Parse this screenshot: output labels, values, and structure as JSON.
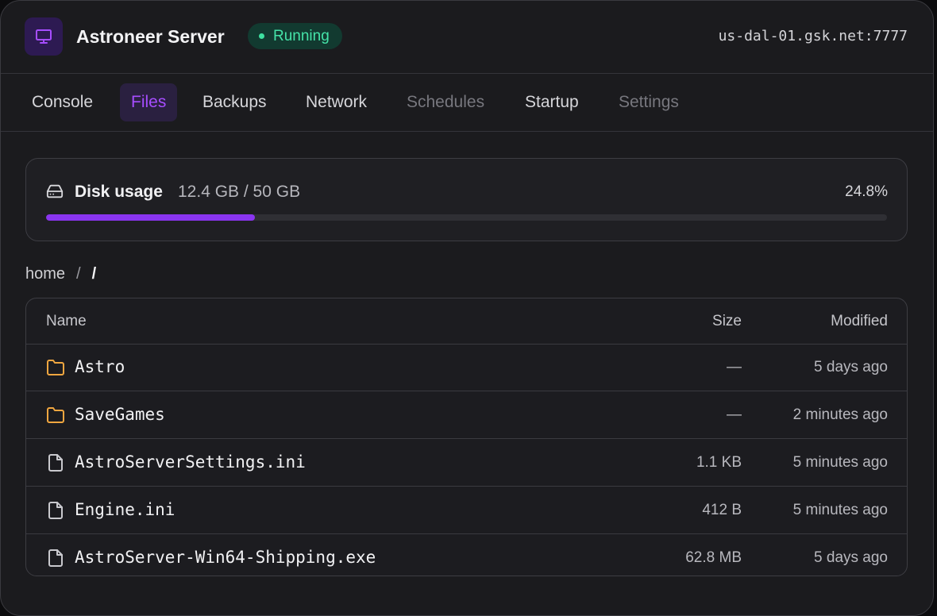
{
  "header": {
    "title": "Astroneer Server",
    "status": "Running",
    "address": "us-dal-01.gsk.net:7777",
    "icon": "monitor-icon"
  },
  "tabs": [
    {
      "label": "Console",
      "state": "normal"
    },
    {
      "label": "Files",
      "state": "active"
    },
    {
      "label": "Backups",
      "state": "normal"
    },
    {
      "label": "Network",
      "state": "normal"
    },
    {
      "label": "Schedules",
      "state": "disabled"
    },
    {
      "label": "Startup",
      "state": "normal"
    },
    {
      "label": "Settings",
      "state": "disabled"
    }
  ],
  "disk": {
    "label": "Disk usage",
    "used": "12.4 GB / 50 GB",
    "percent_label": "24.8%",
    "percent": 24.8,
    "icon": "hard-drive-icon"
  },
  "breadcrumb": {
    "root": "home",
    "separator": "/",
    "current": "/"
  },
  "table": {
    "columns": {
      "name": "Name",
      "size": "Size",
      "modified": "Modified"
    },
    "rows": [
      {
        "name": "Astro",
        "type": "folder",
        "size": "—",
        "modified": "5 days ago"
      },
      {
        "name": "SaveGames",
        "type": "folder",
        "size": "—",
        "modified": "2 minutes ago"
      },
      {
        "name": "AstroServerSettings.ini",
        "type": "file",
        "size": "1.1 KB",
        "modified": "5 minutes ago"
      },
      {
        "name": "Engine.ini",
        "type": "file",
        "size": "412 B",
        "modified": "5 minutes ago"
      },
      {
        "name": "AstroServer-Win64-Shipping.exe",
        "type": "file",
        "size": "62.8 MB",
        "modified": "5 days ago"
      }
    ]
  },
  "colors": {
    "accent": "#8a35f0",
    "accent_text": "#a64dff",
    "status_green": "#45e3a8",
    "folder": "#f0a640",
    "file": "#c9c9ce"
  }
}
